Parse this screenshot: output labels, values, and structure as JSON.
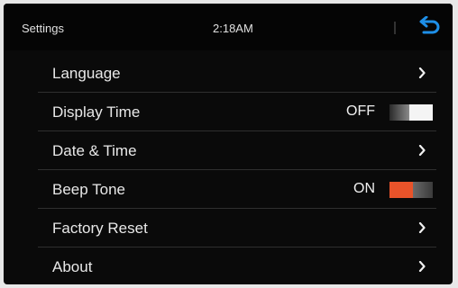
{
  "header": {
    "title": "Settings",
    "time": "2:18AM",
    "back_icon": "back-arrow-icon"
  },
  "settings": {
    "items": [
      {
        "label": "Language",
        "type": "link",
        "icon": "chevron-right-icon"
      },
      {
        "label": "Display Time",
        "type": "toggle",
        "state_label": "OFF",
        "on": false
      },
      {
        "label": "Date & Time",
        "type": "link",
        "icon": "chevron-right-icon"
      },
      {
        "label": "Beep Tone",
        "type": "toggle",
        "state_label": "ON",
        "on": true
      },
      {
        "label": "Factory Reset",
        "type": "link",
        "icon": "chevron-right-icon"
      },
      {
        "label": "About",
        "type": "link",
        "icon": "chevron-right-icon"
      }
    ]
  },
  "colors": {
    "accent": "#e8532a",
    "back_icon": "#1e8fe8",
    "background": "#0a0a0a"
  }
}
